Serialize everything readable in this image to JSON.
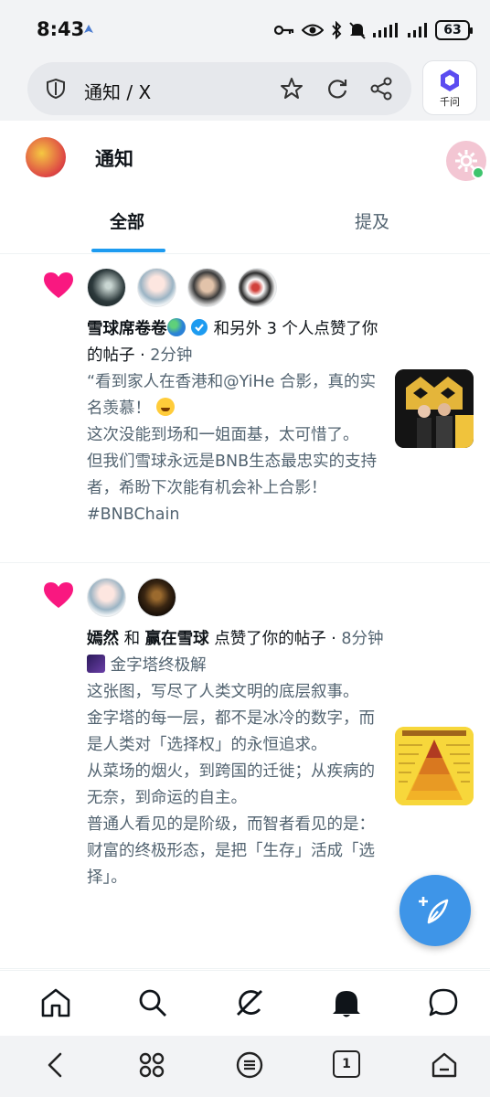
{
  "status_bar": {
    "time": "8:43",
    "battery": "63",
    "icons": [
      "key-icon",
      "eye-icon",
      "bluetooth-icon",
      "mute-icon",
      "signal-icon",
      "signal-icon",
      "battery-icon"
    ]
  },
  "browser": {
    "url_title": "通知 / X",
    "assistant_label": "千问",
    "icons": [
      "shield-icon",
      "star-icon",
      "reload-icon",
      "share-icon"
    ]
  },
  "header": {
    "title": "通知",
    "tabs": [
      {
        "label": "全部",
        "active": true
      },
      {
        "label": "提及",
        "active": false
      }
    ]
  },
  "notifications": [
    {
      "actor": "雪球席卷卷",
      "action": "和另外 3 个人点赞了你的帖子 · ",
      "time": "2分钟",
      "post_lines": [
        "“看到家人在香港和@YiHe 合影，真的实名羡慕！",
        "这次没能到场和一姐面基，太可惜了。",
        "但我们雪球永远是BNB生态最忠实的支持者，希盼下次能有机会补上合影！#BNBChain"
      ]
    },
    {
      "actor_1": "嫣然",
      "joiner": " 和 ",
      "actor_2": "赢在雪球",
      "action": " 点赞了你的帖子 · ",
      "time": "8分钟",
      "post_lines": [
        "金字塔终极解",
        "这张图，写尽了人类文明的底层叙事。",
        "金字塔的每一层，都不是冰冷的数字，而是人类对「选择权」的永恒追求。",
        "从菜场的烟火，到跨国的迁徙；从疾病的无奈，到命运的自主。",
        "普通人看见的是阶级，而智者看见的是：财富的终极形态，是把「生存」活成「选择」。"
      ]
    }
  ],
  "bottom_nav": [
    "home-icon",
    "search-icon",
    "grok-icon",
    "notifications-icon",
    "messages-icon"
  ],
  "system_nav": [
    "back-icon",
    "apps-icon",
    "menu-icon",
    "tabs-icon",
    "home-icon"
  ],
  "tabs_count": "1",
  "colors": {
    "accent": "#1d9bf0",
    "heart": "#f91880",
    "fab": "#3e95e8"
  }
}
